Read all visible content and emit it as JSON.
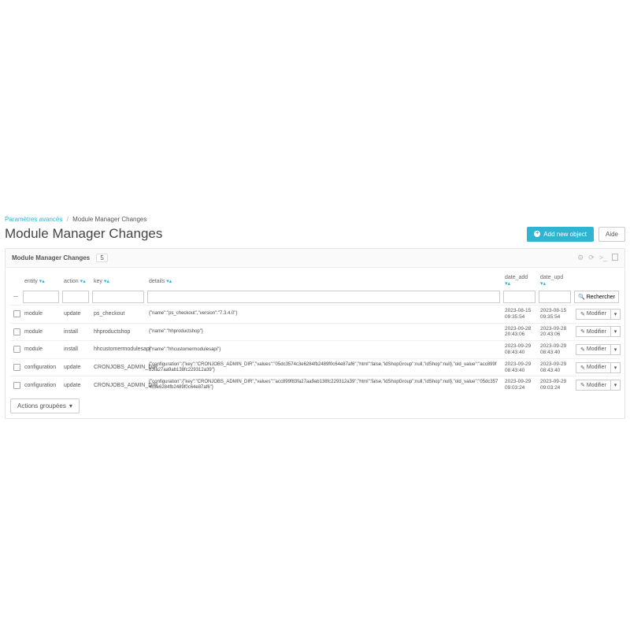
{
  "breadcrumb": {
    "root": "Paramètres avancés",
    "current": "Module Manager Changes"
  },
  "page_title": "Module Manager Changes",
  "header": {
    "add_label": "Add new object",
    "help_label": "Aide"
  },
  "panel": {
    "title": "Module Manager Changes",
    "count": "5"
  },
  "columns": {
    "entity": "entity",
    "action": "action",
    "key": "key",
    "details": "details",
    "date_add": "date_add",
    "date_upd": "date_upd"
  },
  "search_label": "Rechercher",
  "edit_label": "Modifier",
  "bulk_label": "Actions groupées",
  "rows": [
    {
      "entity": "module",
      "action": "update",
      "key": "ps_checkout",
      "details": "{\"name\":\"ps_checkout\",\"version\":\"7.3.4.0\"}",
      "date_add": "2023-08-15 09:35:54",
      "date_upd": "2023-08-15 09:35:54"
    },
    {
      "entity": "module",
      "action": "install",
      "key": "hhproductshop",
      "details": "{\"name\":\"hhproductshop\"}",
      "date_add": "2023-09-28 20:43:06",
      "date_upd": "2023-09-28 20:43:06"
    },
    {
      "entity": "module",
      "action": "install",
      "key": "hhcustomermodulesapi",
      "details": "{\"name\":\"hhcustomermodulesapi\"}",
      "date_add": "2023-09-29 08:43:40",
      "date_upd": "2023-09-29 08:43:40"
    },
    {
      "entity": "configuration",
      "action": "update",
      "key": "CRONJOBS_ADMIN_DIR",
      "details": "{\"configuration\":{\"key\":\"CRONJOBS_ADMIN_DIR\",\"values\":\"05dc3574c3e6284fb2489f0c64e87af6\",\"html\":false,\"idShopGroup\":null,\"idShop\":null},\"old_value\":\"acc899f83fa27aa9ab138fc229312a39\"}",
      "date_add": "2023-09-29 08:43:40",
      "date_upd": "2023-09-29 08:43:40"
    },
    {
      "entity": "configuration",
      "action": "update",
      "key": "CRONJOBS_ADMIN_DIR",
      "details": "{\"configuration\":{\"key\":\"CRONJOBS_ADMIN_DIR\",\"values\":\"acc899f83fa27aa9ab138fc229312a39\",\"html\":false,\"idShopGroup\":null,\"idShop\":null},\"old_value\":\"05dc3574c3e6284fb2489f0c64e87af6\"}",
      "date_add": "2023-09-29 09:03:24",
      "date_upd": "2023-09-29 09:03:24"
    }
  ]
}
